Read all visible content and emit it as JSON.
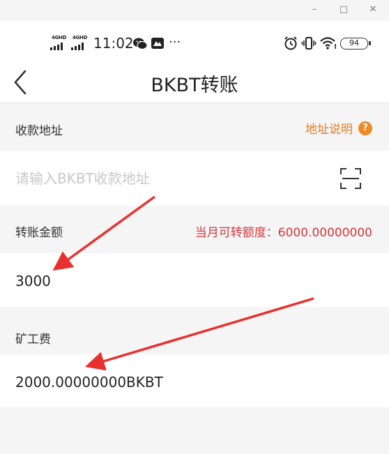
{
  "window": {
    "minimize_glyph": "–",
    "maximize_glyph": "□",
    "close_glyph": "✕"
  },
  "status_bar": {
    "signal_1": "4GHD",
    "signal_2": "4GHD",
    "time": "11:02",
    "more": "···",
    "battery": "94",
    "icons": [
      "wechat-icon",
      "app-notification-icon",
      "alarm-icon",
      "vibrate-icon",
      "wifi-icon",
      "battery-icon"
    ]
  },
  "nav": {
    "title": "BKBT转账",
    "back_icon": "chevron-left-icon"
  },
  "address": {
    "label": "收款地址",
    "help_link": "地址说明",
    "help_icon": "?",
    "placeholder": "请输入BKBT收款地址",
    "scan_icon": "scan-qr-icon"
  },
  "amount": {
    "label": "转账金额",
    "limit_text": "当月可转额度：6000.00000000",
    "value": "3000"
  },
  "fee": {
    "label": "矿工费",
    "value": "2000.00000000BKBT"
  },
  "colors": {
    "accent_orange": "#e97a1f",
    "limit_red": "#d7373b",
    "arrow_red": "#e8312f",
    "background": "#f5f5f5"
  }
}
